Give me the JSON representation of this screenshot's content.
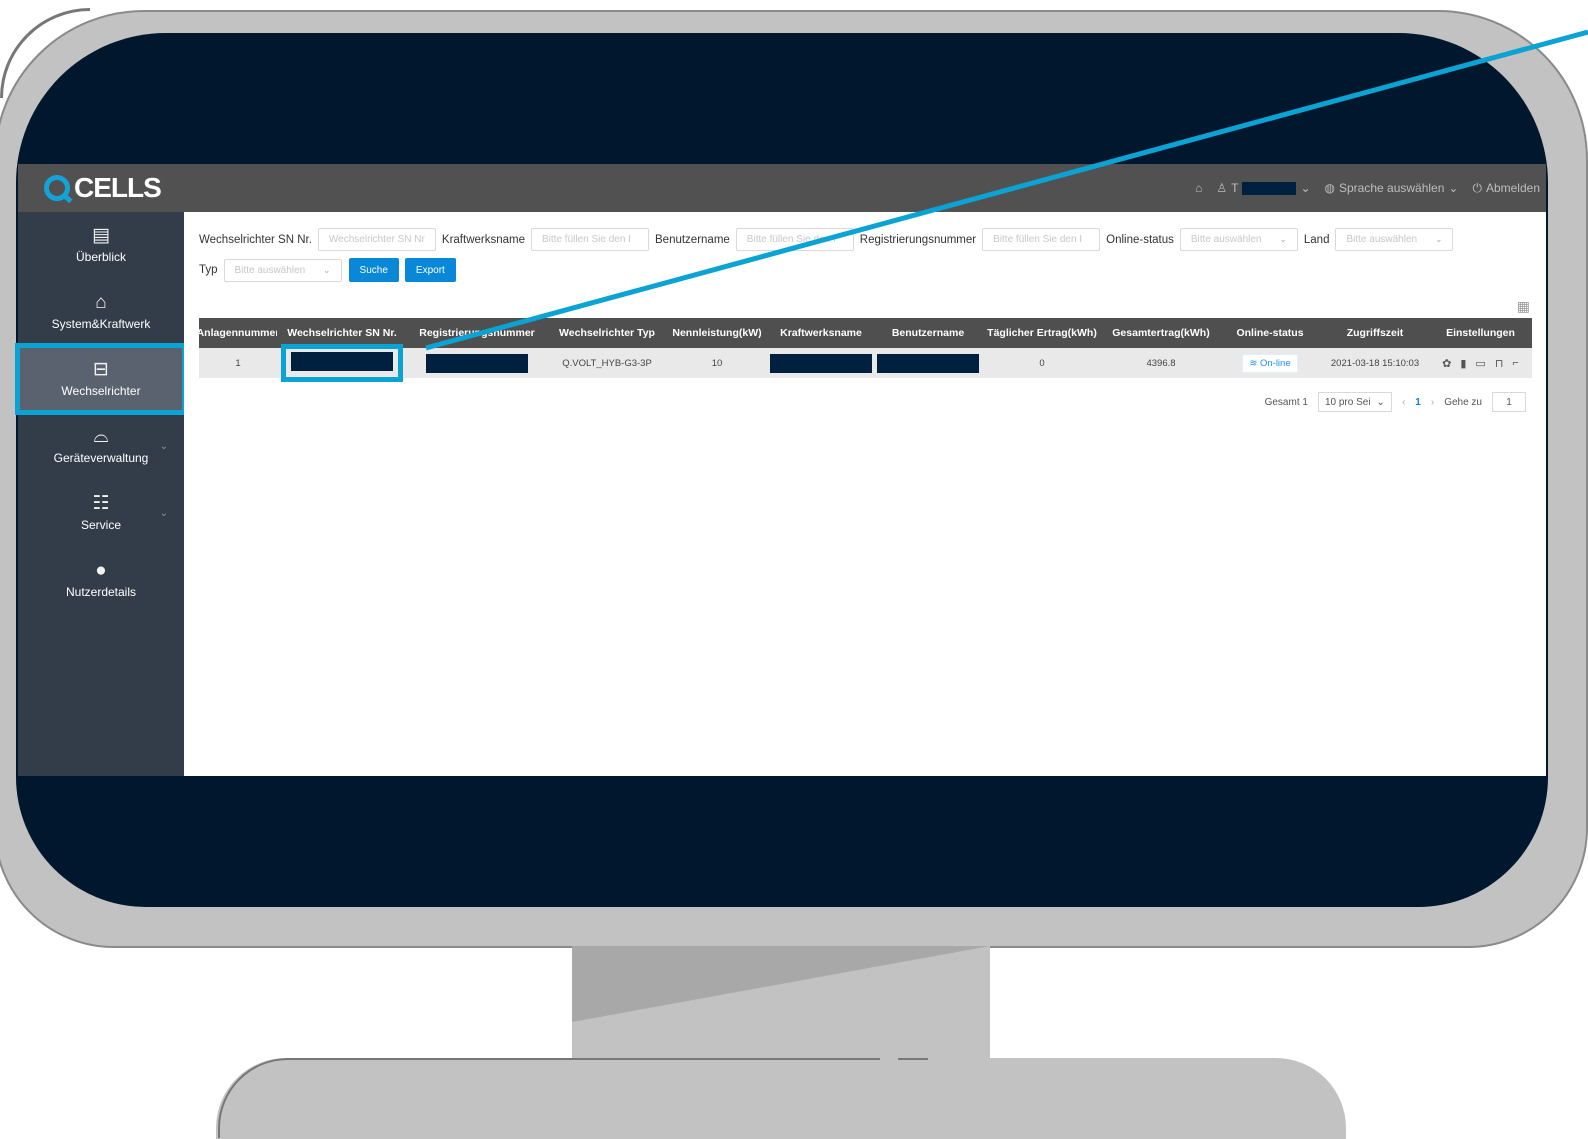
{
  "brand": {
    "name": "CELLS"
  },
  "topbar": {
    "user_initial": "T",
    "language_label": "Sprache auswählen",
    "logout_label": "Abmelden"
  },
  "sidebar": {
    "items": [
      {
        "label": "Überblick",
        "icon": "document-icon"
      },
      {
        "label": "System&Kraftwerk",
        "icon": "house-bolt-icon"
      },
      {
        "label": "Wechselrichter",
        "icon": "inverter-icon",
        "active": true
      },
      {
        "label": "Geräteverwaltung",
        "icon": "router-icon"
      },
      {
        "label": "Service",
        "icon": "network-icon"
      },
      {
        "label": "Nutzerdetails",
        "icon": "user-icon"
      }
    ]
  },
  "filters": {
    "sn_label": "Wechselrichter SN Nr.",
    "sn_placeholder": "Wechselrichter SN Nr",
    "plant_label": "Kraftwerksname",
    "plant_placeholder": "Bitte füllen Sie den I",
    "user_label": "Benutzername",
    "user_placeholder": "Bitte füllen Sie den I",
    "reg_label": "Registrierungsnummer",
    "reg_placeholder": "Bitte füllen Sie den I",
    "status_label": "Online-status",
    "status_placeholder": "Bitte auswählen",
    "country_label": "Land",
    "country_placeholder": "Bitte auswählen",
    "type_label": "Typ",
    "type_placeholder": "Bitte auswählen",
    "search_button": "Suche",
    "export_button": "Export"
  },
  "table": {
    "columns": [
      "Anlagennummer",
      "Wechselrichter SN Nr.",
      "Registrierungsnummer",
      "Wechselrichter Typ",
      "Nennleistung(kW)",
      "Kraftwerksname",
      "Benutzername",
      "Täglicher Ertrag(kWh)",
      "Gesamtertrag(kWh)",
      "Online-status",
      "Zugriffszeit",
      "Einstellungen"
    ],
    "rows": [
      {
        "number": "1",
        "type": "Q.VOLT_HYB-G3-3P",
        "rated_power": "10",
        "daily_yield": "0",
        "total_yield": "4396.8",
        "status": "On-line",
        "access_time": "2021-03-18 15:10:03"
      }
    ]
  },
  "pagination": {
    "total_label": "Gesamt 1",
    "page_size": "10 pro Sei",
    "current_page": "1",
    "goto_label": "Gehe zu",
    "goto_value": "1"
  },
  "colors": {
    "accent": "#0aa3d3",
    "primary_button": "#0a88d8",
    "sidebar": "#333d4a",
    "topbar": "#515151",
    "screen_bg": "#00172e"
  }
}
